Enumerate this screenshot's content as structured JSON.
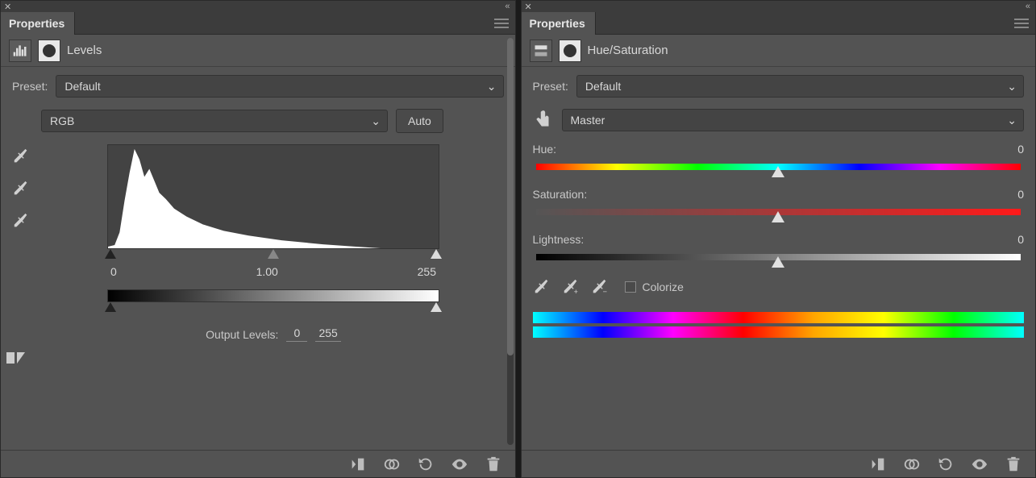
{
  "left": {
    "tab_title": "Properties",
    "adjustment_title": "Levels",
    "preset_label": "Preset:",
    "preset_value": "Default",
    "channel_value": "RGB",
    "auto_label": "Auto",
    "input_black": "0",
    "input_gamma": "1.00",
    "input_white": "255",
    "output_label": "Output Levels:",
    "output_black": "0",
    "output_white": "255"
  },
  "right": {
    "tab_title": "Properties",
    "adjustment_title": "Hue/Saturation",
    "preset_label": "Preset:",
    "preset_value": "Default",
    "range_value": "Master",
    "hue_label": "Hue:",
    "hue_value": "0",
    "sat_label": "Saturation:",
    "sat_value": "0",
    "light_label": "Lightness:",
    "light_value": "0",
    "colorize_label": "Colorize"
  }
}
